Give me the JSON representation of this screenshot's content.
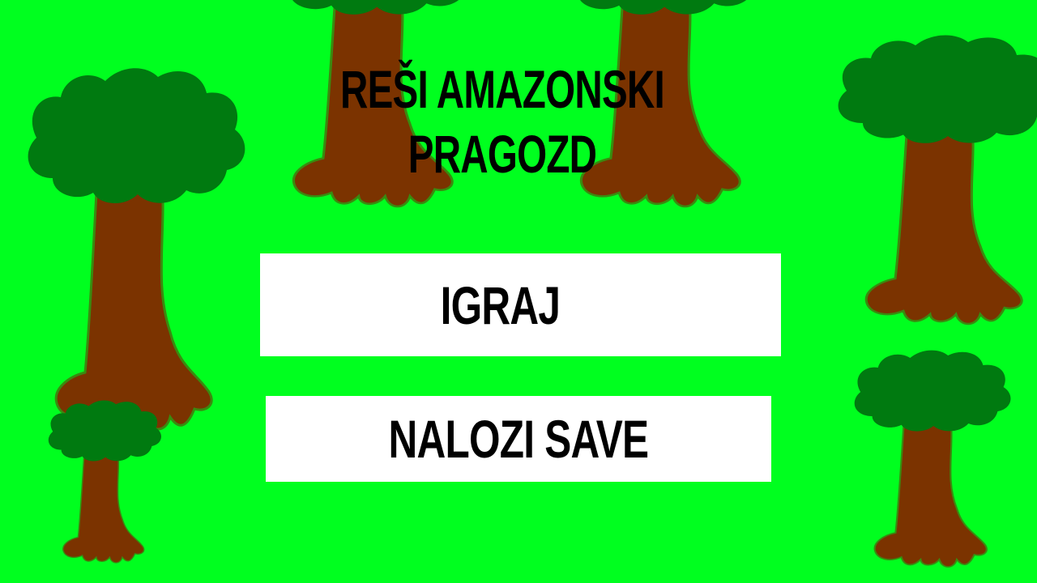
{
  "title": {
    "line1": "REŠI AMAZONSKI",
    "line2": "PRAGOZD"
  },
  "menu": {
    "play_label": "IGRAJ",
    "load_label": "NALOZI SAVE"
  },
  "colors": {
    "background": "#00ff1f",
    "trunk": "#7b3300",
    "foliage": "#007a10",
    "button": "#ffffff"
  }
}
